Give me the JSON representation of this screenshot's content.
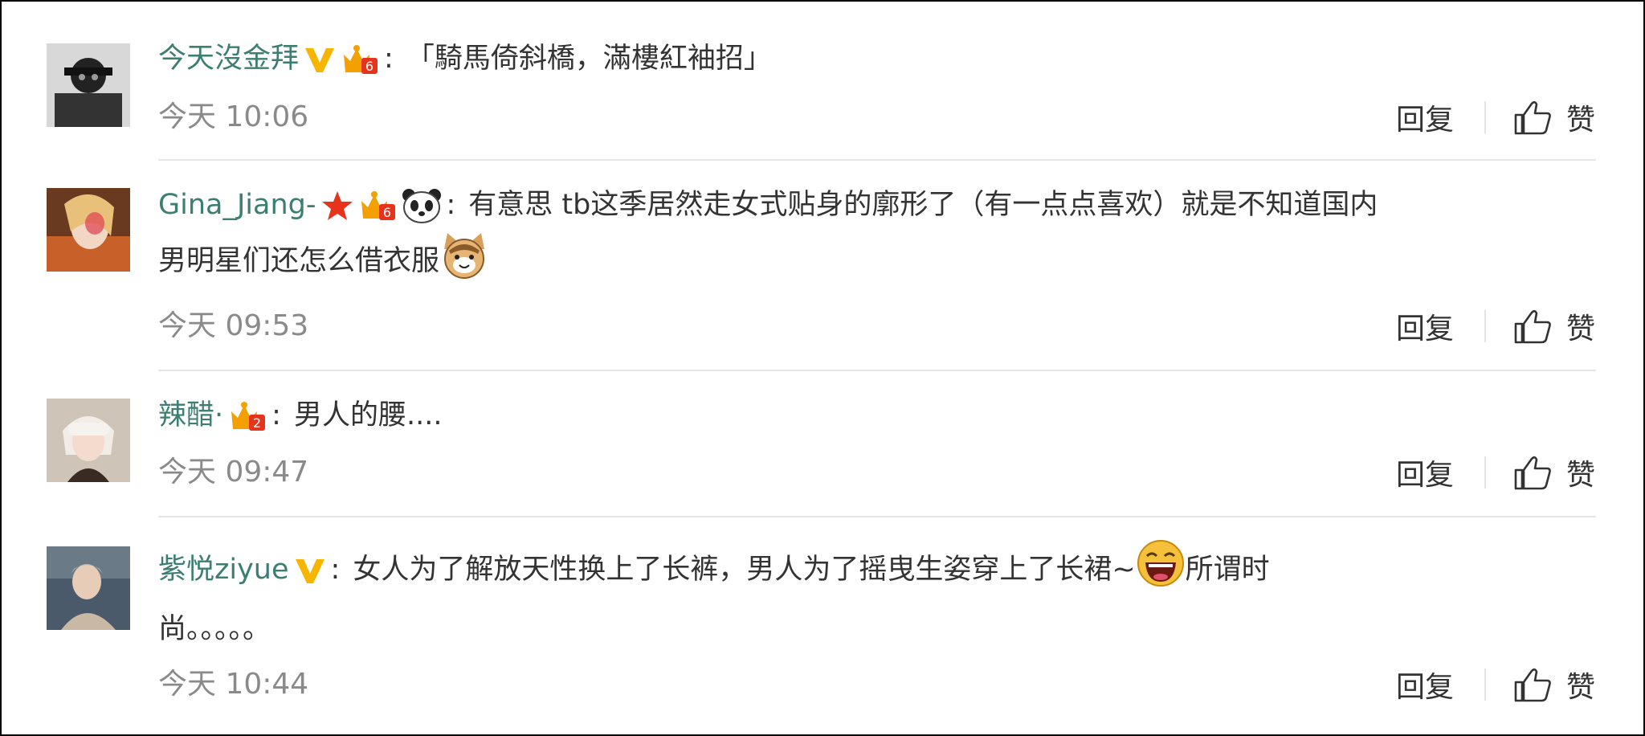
{
  "comments": [
    {
      "author": "今天沒金拜",
      "text": "「騎馬倚斜橋，滿樓紅袖招」",
      "time": "今天 10:06",
      "reply_label": "回复",
      "like_label": "赞",
      "badges": [
        "verified-v-icon",
        "vip-crown-6-icon"
      ],
      "vip_level": "6"
    },
    {
      "author": "Gina_Jiang-",
      "text_line1": "有意思 tb这季居然走女式贴身的廓形了（有一点点喜欢）就是不知道国内",
      "text_line2": "男明星们还怎么借衣服",
      "time": "今天 09:53",
      "reply_label": "回复",
      "like_label": "赞",
      "badges": [
        "red-star-icon",
        "vip-crown-6-icon",
        "panda-icon"
      ],
      "vip_level": "6",
      "emoji": "cat-face-emoji"
    },
    {
      "author": "辣醋·",
      "text": "男人的腰....",
      "time": "今天 09:47",
      "reply_label": "回复",
      "like_label": "赞",
      "badges": [
        "vip-crown-2-icon"
      ],
      "vip_level": "2"
    },
    {
      "author": "紫悦ziyue",
      "text_line1a": "女人为了解放天性换上了长裤，男人为了摇曳生姿穿上了长裙~",
      "text_line1b": "所谓时",
      "text_line2": "尚。。。。。",
      "time": "今天 10:44",
      "reply_label": "回复",
      "like_label": "赞",
      "badges": [
        "verified-v-icon"
      ],
      "emoji": "laughing-face-emoji"
    }
  ],
  "colors": {
    "author": "#3d7e72",
    "text": "#333333",
    "time": "#8a8a8a",
    "divider": "#e6e6e6",
    "verified": "#f7b500",
    "vip": "#f4a000",
    "star": "#e8331c"
  }
}
